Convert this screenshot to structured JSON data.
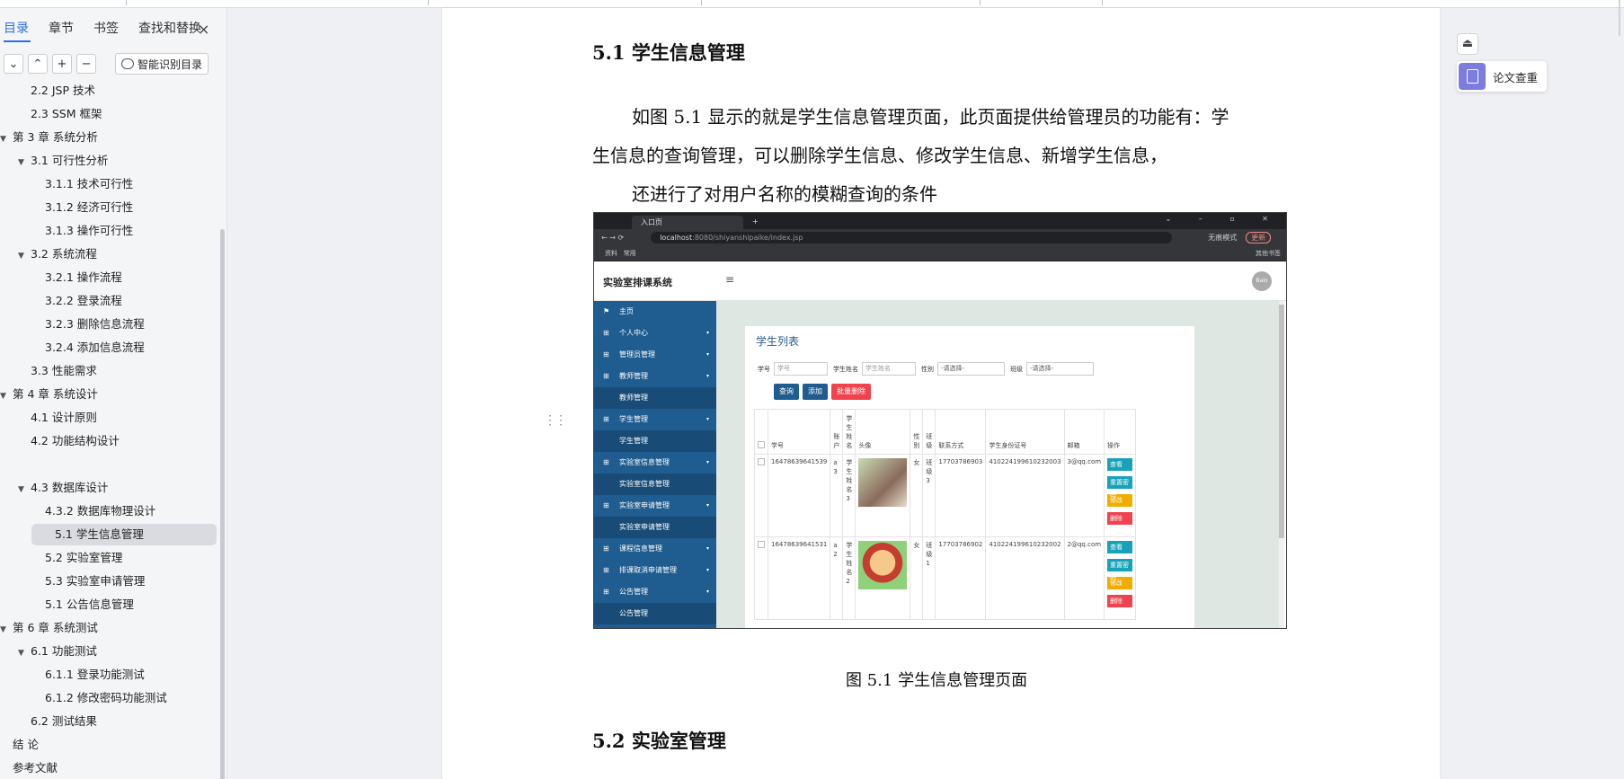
{
  "nav": {
    "tabs": [
      "目录",
      "章节",
      "书签",
      "查找和替换"
    ],
    "close_icon": "×",
    "tool_buttons": [
      "⌄",
      "⌃",
      "+",
      "−"
    ],
    "smart_label": "智能识别目录",
    "toc": [
      {
        "label": "2.2 JSP 技术",
        "level": 2
      },
      {
        "label": "2.3 SSM 框架",
        "level": 2
      },
      {
        "label": "第 3 章  系统分析",
        "level": 1
      },
      {
        "label": "3.1 可行性分析",
        "level": 2
      },
      {
        "label": "3.1.1  技术可行性",
        "level": 3
      },
      {
        "label": "3.1.2  经济可行性",
        "level": 3
      },
      {
        "label": "3.1.3  操作可行性",
        "level": 3
      },
      {
        "label": "3.2  系统流程",
        "level": 2
      },
      {
        "label": "3.2.1  操作流程",
        "level": 3
      },
      {
        "label": "3.2.2  登录流程",
        "level": 3
      },
      {
        "label": "3.2.3  删除信息流程",
        "level": 3
      },
      {
        "label": "3.2.4  添加信息流程",
        "level": 3
      },
      {
        "label": "3.3  性能需求",
        "level": 2
      },
      {
        "label": "第 4 章  系统设计",
        "level": 1
      },
      {
        "label": "4.1  设计原则",
        "level": 2
      },
      {
        "label": "4.2  功能结构设计",
        "level": 2
      },
      {
        "label": "4.3  数据库设计",
        "level": 2
      },
      {
        "label": "4.3.2  数据库物理设计",
        "level": 3
      },
      {
        "label": "5.1 学生信息管理",
        "level": 3
      },
      {
        "label": "5.2  实验室管理",
        "level": 3
      },
      {
        "label": "5.3 实验室申请管理",
        "level": 3
      },
      {
        "label": "5.1 公告信息管理",
        "level": 3
      },
      {
        "label": "第 6 章  系统测试",
        "level": 1
      },
      {
        "label": "6.1  功能测试",
        "level": 2
      },
      {
        "label": "6.1.1  登录功能测试",
        "level": 3
      },
      {
        "label": "6.1.2  修改密码功能测试",
        "level": 3
      },
      {
        "label": "6.2  测试结果",
        "level": 2
      },
      {
        "label": "结   论",
        "level": 1
      },
      {
        "label": "参考文献",
        "level": 1
      }
    ]
  },
  "doc": {
    "heading_51": "5.1 学生信息管理",
    "para_line1": "如图 5.1 显示的就是学生信息管理页面，此页面提供给管理员的功能有：学",
    "para_line2": "生信息的查询管理，可以删除学生信息、修改学生信息、新增学生信息，",
    "para_line3": "还进行了对用户名称的模糊查询的条件",
    "caption": "图 5.1  学生信息管理页面",
    "heading_52": "5.2  实验室管理"
  },
  "figure": {
    "tab_title": "入口页",
    "url_host": "localhost",
    "url_rest": ":8080/shiyanshipaike/index.jsp",
    "bookmarks": [
      "资料",
      "常用"
    ],
    "bookmarks_right": "其他书签",
    "incognito": "无痕模式",
    "update": "更新",
    "app_title": "实验室排课系统",
    "avatar": "Balo",
    "sidebar": [
      {
        "label": "主页",
        "sub": false
      },
      {
        "label": "个人中心",
        "sub": false
      },
      {
        "label": "管理员管理",
        "sub": false
      },
      {
        "label": "教师管理",
        "sub": false
      },
      {
        "label": "教师管理",
        "sub": true
      },
      {
        "label": "学生管理",
        "sub": false
      },
      {
        "label": "学生管理",
        "sub": true
      },
      {
        "label": "实验室信息管理",
        "sub": false
      },
      {
        "label": "实验室信息管理",
        "sub": true
      },
      {
        "label": "实验室申请管理",
        "sub": false
      },
      {
        "label": "实验室申请管理",
        "sub": true
      },
      {
        "label": "课程信息管理",
        "sub": false
      },
      {
        "label": "排课取消申请管理",
        "sub": false
      },
      {
        "label": "公告管理",
        "sub": false
      },
      {
        "label": "公告管理",
        "sub": true
      }
    ],
    "card_title": "学生列表",
    "filter": {
      "l1": "学号",
      "p1": "学号",
      "l2": "学生姓名",
      "p2": "学生姓名",
      "l3": "性别",
      "s3": "-请选择-",
      "l4": "班级",
      "s4": "-请选择-"
    },
    "actions": {
      "query": "查询",
      "add": "添加",
      "batch_delete": "批量删除"
    },
    "columns": [
      "学号",
      "账户",
      "学生姓名",
      "头像",
      "性别",
      "班级",
      "联系方式",
      "学生身份证号",
      "邮箱",
      "操作"
    ],
    "rows": [
      {
        "id": "16478639641539",
        "account": "a3",
        "name": "学生姓名3",
        "gender": "女",
        "class": "班级3",
        "phone": "17703786903",
        "idcard": "410224199610232003",
        "email": "3@qq.com"
      },
      {
        "id": "16478639641531",
        "account": "a2",
        "name": "学生姓名2",
        "gender": "女",
        "class": "班级1",
        "phone": "17703786902",
        "idcard": "410224199610232002",
        "email": "2@qq.com"
      }
    ],
    "ops": [
      "查看",
      "重置密码",
      "修改",
      "删除"
    ]
  },
  "float": {
    "top_icon": "⏏",
    "check_label": "论文查重"
  },
  "colors": {
    "accent": "#2b6ee8",
    "sidebar": "#1f5c8f",
    "btn_blue": "#1f5c8f",
    "btn_red": "#f0434e",
    "op_teal": "#17a2b8",
    "op_yellow": "#f0ad00"
  }
}
